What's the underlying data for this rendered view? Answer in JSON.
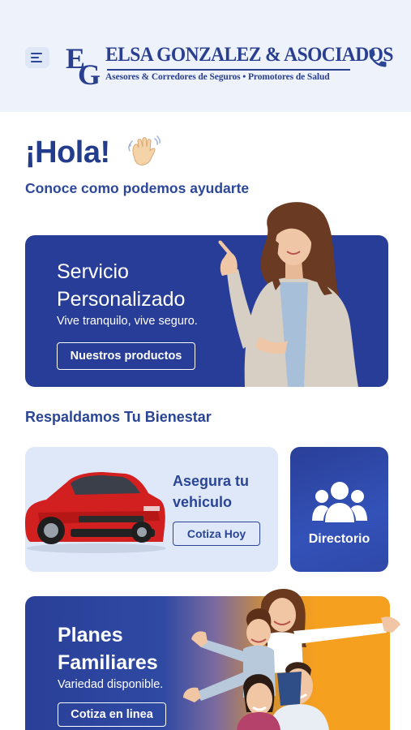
{
  "header": {
    "logo_name": "ELSA GONZALEZ & ASOCIADOS",
    "logo_tagline": "Asesores & Corredores de Seguros • Promotores de Salud",
    "menu_icon": "menu-icon",
    "phone_icon": "phone-icon"
  },
  "greeting": {
    "title": "¡Hola!",
    "emoji": "waving-hand",
    "subtitle": "Conoce como podemos ayudarte"
  },
  "hero_card": {
    "title": "Servicio Personalizado",
    "subtitle": "Vive tranquilo, vive seguro.",
    "button": "Nuestros productos"
  },
  "section": {
    "title": "Respaldamos Tu Bienestar"
  },
  "vehicle_card": {
    "title": "Asegura tu vehiculo",
    "button": "Cotiza Hoy"
  },
  "directory_card": {
    "label": "Directorio",
    "icon": "group-icon"
  },
  "family_card": {
    "title": "Planes Familiares",
    "subtitle": "Variedad disponible.",
    "button": "Cotiza en linea"
  },
  "colors": {
    "brand_blue": "#273d97",
    "header_bg": "#eef3fb",
    "light_card": "#dfe8f8",
    "accent_orange": "#f6a020"
  }
}
